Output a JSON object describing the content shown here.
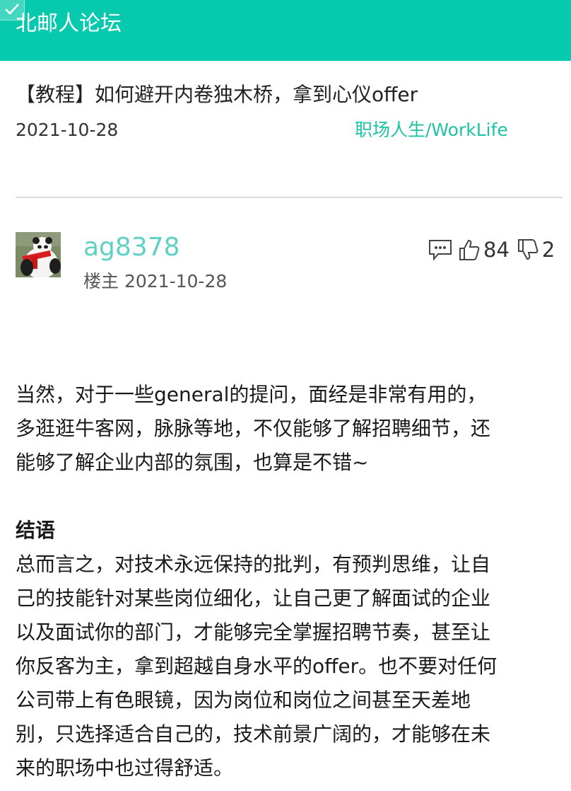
{
  "app": {
    "title": "北邮人论坛"
  },
  "post": {
    "title": "【教程】如何避开内卷独木桥，拿到心仪offer",
    "date": "2021-10-28",
    "board": "职场人生/WorkLife"
  },
  "reply": {
    "author": "ag8378",
    "role": "楼主",
    "date": "2021-10-28",
    "likes": "84",
    "dislikes": "2",
    "icons": [
      "comment-icon",
      "thumbs-up-icon",
      "thumbs-down-icon"
    ]
  },
  "content": {
    "para1_lines": [
      "当然，对于一些general的提问，面经是非常有用的，",
      "多逛逛牛客网，脉脉等地，不仅能够了解招聘细节，还",
      "能够了解企业内部的氛围，也算是不错~"
    ],
    "heading": "结语",
    "para2_lines": [
      "总而言之，对技术永远保持的批判，有预判思维，让自",
      "己的技能针对某些岗位细化，让自己更了解面试的企业",
      "以及面试你的部门，才能够完全掌握招聘节奏，甚至让",
      "你反客为主，拿到超越自身水平的offer。也不要对任何",
      "公司带上有色眼镜，因为岗位和岗位之间甚至天差地",
      "别，只选择适合自己的，技术前景广阔的，才能够在未",
      "来的职场中也过得舒适。"
    ]
  },
  "colors": {
    "accent": "#07c9ae",
    "link": "#1cc4a4",
    "author": "#5fd1c4"
  }
}
